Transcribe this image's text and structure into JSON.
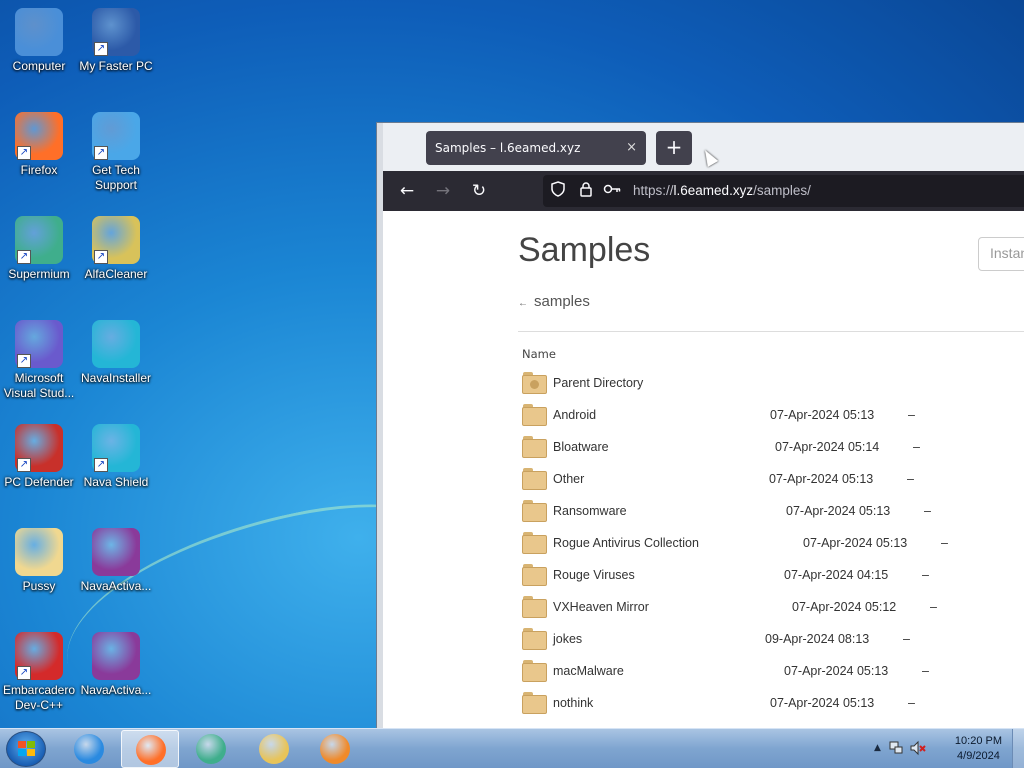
{
  "desktop": {
    "icons": [
      {
        "label": "Computer",
        "icon": "computer-icon",
        "color": "#4a8fd8",
        "shortcut": false
      },
      {
        "label": "My Faster PC",
        "icon": "shield-monitor-icon",
        "color": "#2c5aa8",
        "shortcut": true
      },
      {
        "label": "Firefox",
        "icon": "firefox-icon",
        "color": "#ff6f28",
        "shortcut": true
      },
      {
        "label": "Get Tech Support",
        "icon": "support-shield-icon",
        "color": "#4aa7e8",
        "shortcut": true
      },
      {
        "label": "Supermium",
        "icon": "supermium-icon",
        "color": "#3fae8c",
        "shortcut": true
      },
      {
        "label": "AlfaCleaner",
        "icon": "cleaner-icon",
        "color": "#d8c25a",
        "shortcut": true
      },
      {
        "label": "Microsoft Visual Stud...",
        "icon": "visual-studio-icon",
        "color": "#6a5acd",
        "shortcut": true
      },
      {
        "label": "NavaInstaller",
        "icon": "nava-shield-icon",
        "color": "#24b6d6",
        "shortcut": false
      },
      {
        "label": "PC Defender",
        "icon": "pc-defender-icon",
        "color": "#c8302a",
        "shortcut": true
      },
      {
        "label": "Nava Shield",
        "icon": "nava-shield-icon",
        "color": "#24b6d6",
        "shortcut": true
      },
      {
        "label": "Pussy",
        "icon": "folder-icon",
        "color": "#f0d890",
        "shortcut": false
      },
      {
        "label": "NavaActiva...",
        "icon": "winrar-archive-icon",
        "color": "#8a3a9a",
        "shortcut": false
      },
      {
        "label": "Embarcadero Dev-C++",
        "icon": "devcpp-icon",
        "color": "#d42a2a",
        "shortcut": true
      },
      {
        "label": "NavaActiva...",
        "icon": "winrar-archive-icon",
        "color": "#8a3a9a",
        "shortcut": false
      }
    ]
  },
  "browser": {
    "tab_title": "Samples – l.6eamed.xyz",
    "tab_close": "×",
    "new_tab": "+",
    "nav": {
      "back": "←",
      "forward": "→",
      "reload": "↻"
    },
    "url_prefix": "https://",
    "url_host": "l.6eamed.xyz",
    "url_path": "/samples/",
    "page": {
      "title": "Samples",
      "search_placeholder": "Instan",
      "breadcrumb_arrow": "←",
      "breadcrumb": "samples",
      "column_name": "Name",
      "rows": [
        {
          "name": "Parent Directory",
          "date": "",
          "size": "",
          "parent": true
        },
        {
          "name": "Android",
          "date": "07-Apr-2024 05:13",
          "size": "–"
        },
        {
          "name": "Bloatware",
          "date": "07-Apr-2024 05:14",
          "size": "–"
        },
        {
          "name": "Other",
          "date": "07-Apr-2024 05:13",
          "size": "–"
        },
        {
          "name": "Ransomware",
          "date": "07-Apr-2024 05:13",
          "size": "–"
        },
        {
          "name": "Rogue Antivirus Collection",
          "date": "07-Apr-2024 05:13",
          "size": "–"
        },
        {
          "name": "Rouge Viruses",
          "date": "07-Apr-2024 04:15",
          "size": "–"
        },
        {
          "name": "VXHeaven Mirror",
          "date": "07-Apr-2024 05:12",
          "size": "–"
        },
        {
          "name": "jokes",
          "date": "09-Apr-2024 08:13",
          "size": "–"
        },
        {
          "name": "macMalware",
          "date": "07-Apr-2024 05:13",
          "size": "–"
        },
        {
          "name": "nothink",
          "date": "07-Apr-2024 05:13",
          "size": "–"
        }
      ]
    }
  },
  "taskbar": {
    "apps": [
      {
        "icon": "internet-explorer-icon",
        "color": "#2a8ae0",
        "active": false
      },
      {
        "icon": "firefox-icon",
        "color": "#ff6f28",
        "active": true
      },
      {
        "icon": "supermium-icon",
        "color": "#3fae8c",
        "active": false
      },
      {
        "icon": "file-explorer-icon",
        "color": "#e8c45a",
        "active": false
      },
      {
        "icon": "media-player-icon",
        "color": "#f08a2a",
        "active": false
      }
    ],
    "clock_time": "10:20 PM",
    "clock_date": "4/9/2024"
  }
}
